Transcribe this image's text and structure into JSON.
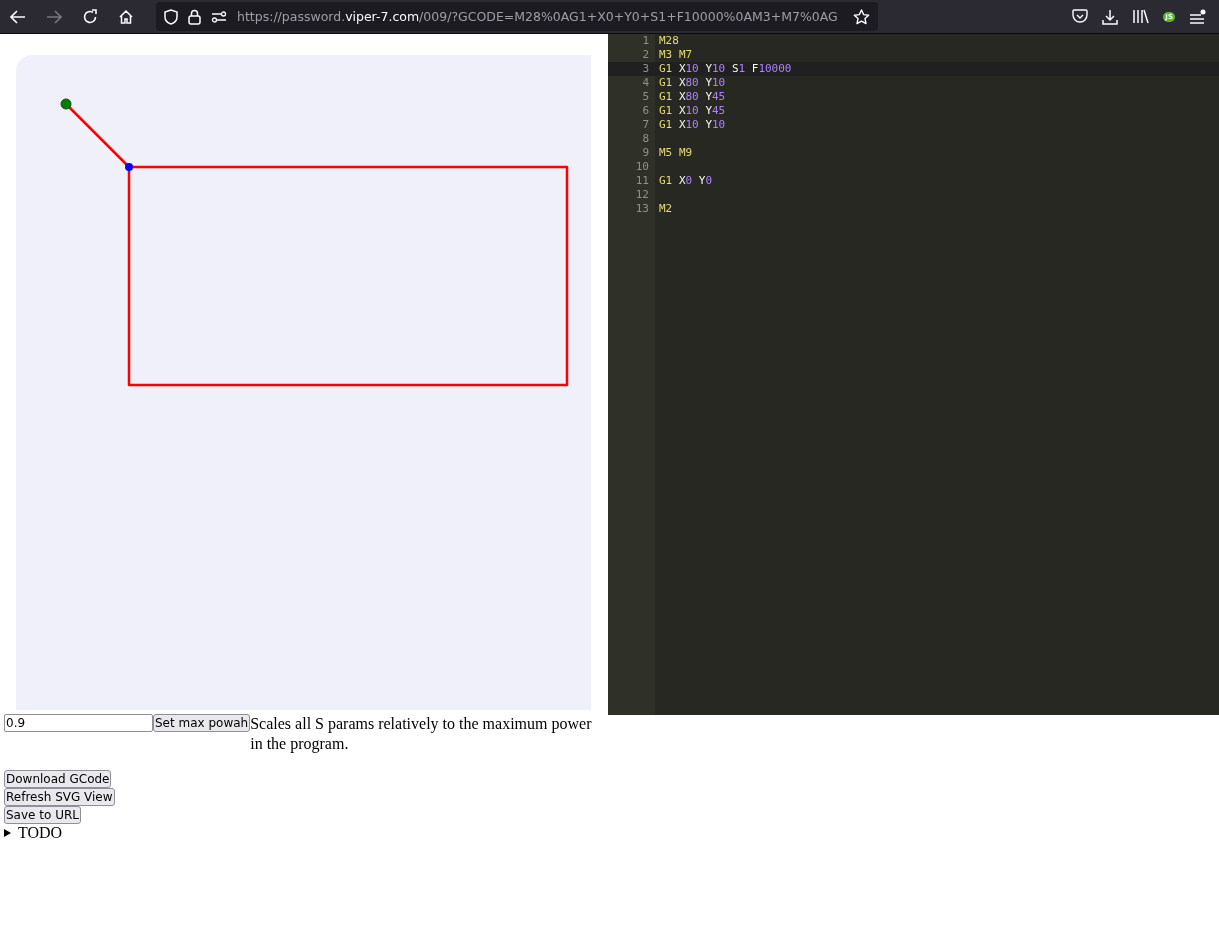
{
  "browser": {
    "url_scheme": "https://password.",
    "url_domain": "viper-7.com",
    "url_path": "/009/?GCODE=M28%0AG1+X0+Y0+S1+F10000%0AM3+M7%0AG",
    "forward_disabled": true,
    "extension_label": "JS"
  },
  "power": {
    "value": "0.9",
    "button": "Set max powah",
    "description": "Scales all S params relatively to the maximum power in the program."
  },
  "buttons": [
    "Download GCode",
    "Refresh SVG View",
    "Save to URL"
  ],
  "details": {
    "summary": "TODO",
    "expanded": false
  },
  "editor": {
    "lines": [
      {
        "number": "1",
        "active": false,
        "words": [
          [
            {
              "t": "M28",
              "kind": "cmd"
            }
          ]
        ]
      },
      {
        "number": "2",
        "active": false,
        "words": [
          [
            {
              "t": "M3",
              "kind": "cmd"
            }
          ],
          [
            {
              "t": "M7",
              "kind": "cmd"
            }
          ]
        ]
      },
      {
        "number": "3",
        "active": true,
        "words": [
          [
            {
              "t": "G1",
              "kind": "cmd"
            }
          ],
          [
            {
              "t": "X",
              "kind": "addr"
            },
            {
              "t": "10",
              "kind": "num"
            }
          ],
          [
            {
              "t": "Y",
              "kind": "addr"
            },
            {
              "t": "10",
              "kind": "num"
            }
          ],
          [
            {
              "t": "S",
              "kind": "addr"
            },
            {
              "t": "1",
              "kind": "num"
            }
          ],
          [
            {
              "t": "F",
              "kind": "addr"
            },
            {
              "t": "10000",
              "kind": "num"
            }
          ]
        ]
      },
      {
        "number": "4",
        "active": false,
        "words": [
          [
            {
              "t": "G1",
              "kind": "cmd"
            }
          ],
          [
            {
              "t": "X",
              "kind": "addr"
            },
            {
              "t": "80",
              "kind": "num"
            }
          ],
          [
            {
              "t": "Y",
              "kind": "addr"
            },
            {
              "t": "10",
              "kind": "num"
            }
          ]
        ]
      },
      {
        "number": "5",
        "active": false,
        "words": [
          [
            {
              "t": "G1",
              "kind": "cmd"
            }
          ],
          [
            {
              "t": "X",
              "kind": "addr"
            },
            {
              "t": "80",
              "kind": "num"
            }
          ],
          [
            {
              "t": "Y",
              "kind": "addr"
            },
            {
              "t": "45",
              "kind": "num"
            }
          ]
        ]
      },
      {
        "number": "6",
        "active": false,
        "words": [
          [
            {
              "t": "G1",
              "kind": "cmd"
            }
          ],
          [
            {
              "t": "X",
              "kind": "addr"
            },
            {
              "t": "10",
              "kind": "num"
            }
          ],
          [
            {
              "t": "Y",
              "kind": "addr"
            },
            {
              "t": "45",
              "kind": "num"
            }
          ]
        ]
      },
      {
        "number": "7",
        "active": false,
        "words": [
          [
            {
              "t": "G1",
              "kind": "cmd"
            }
          ],
          [
            {
              "t": "X",
              "kind": "addr"
            },
            {
              "t": "10",
              "kind": "num"
            }
          ],
          [
            {
              "t": "Y",
              "kind": "addr"
            },
            {
              "t": "10",
              "kind": "num"
            }
          ]
        ]
      },
      {
        "number": "8",
        "active": false
      },
      {
        "number": "9",
        "active": false,
        "words": [
          [
            {
              "t": "M5",
              "kind": "cmd"
            }
          ],
          [
            {
              "t": "M9",
              "kind": "cmd"
            }
          ]
        ]
      },
      {
        "number": "10",
        "active": false
      },
      {
        "number": "11",
        "active": false,
        "words": [
          [
            {
              "t": "G1",
              "kind": "cmd"
            }
          ],
          [
            {
              "t": "X",
              "kind": "addr"
            },
            {
              "t": "0",
              "kind": "num"
            }
          ],
          [
            {
              "t": "Y",
              "kind": "addr"
            },
            {
              "t": "0",
              "kind": "num"
            }
          ]
        ]
      },
      {
        "number": "12",
        "active": false
      },
      {
        "number": "13",
        "active": false,
        "words": [
          [
            {
              "t": "M2",
              "kind": "cmd"
            }
          ]
        ]
      }
    ]
  }
}
